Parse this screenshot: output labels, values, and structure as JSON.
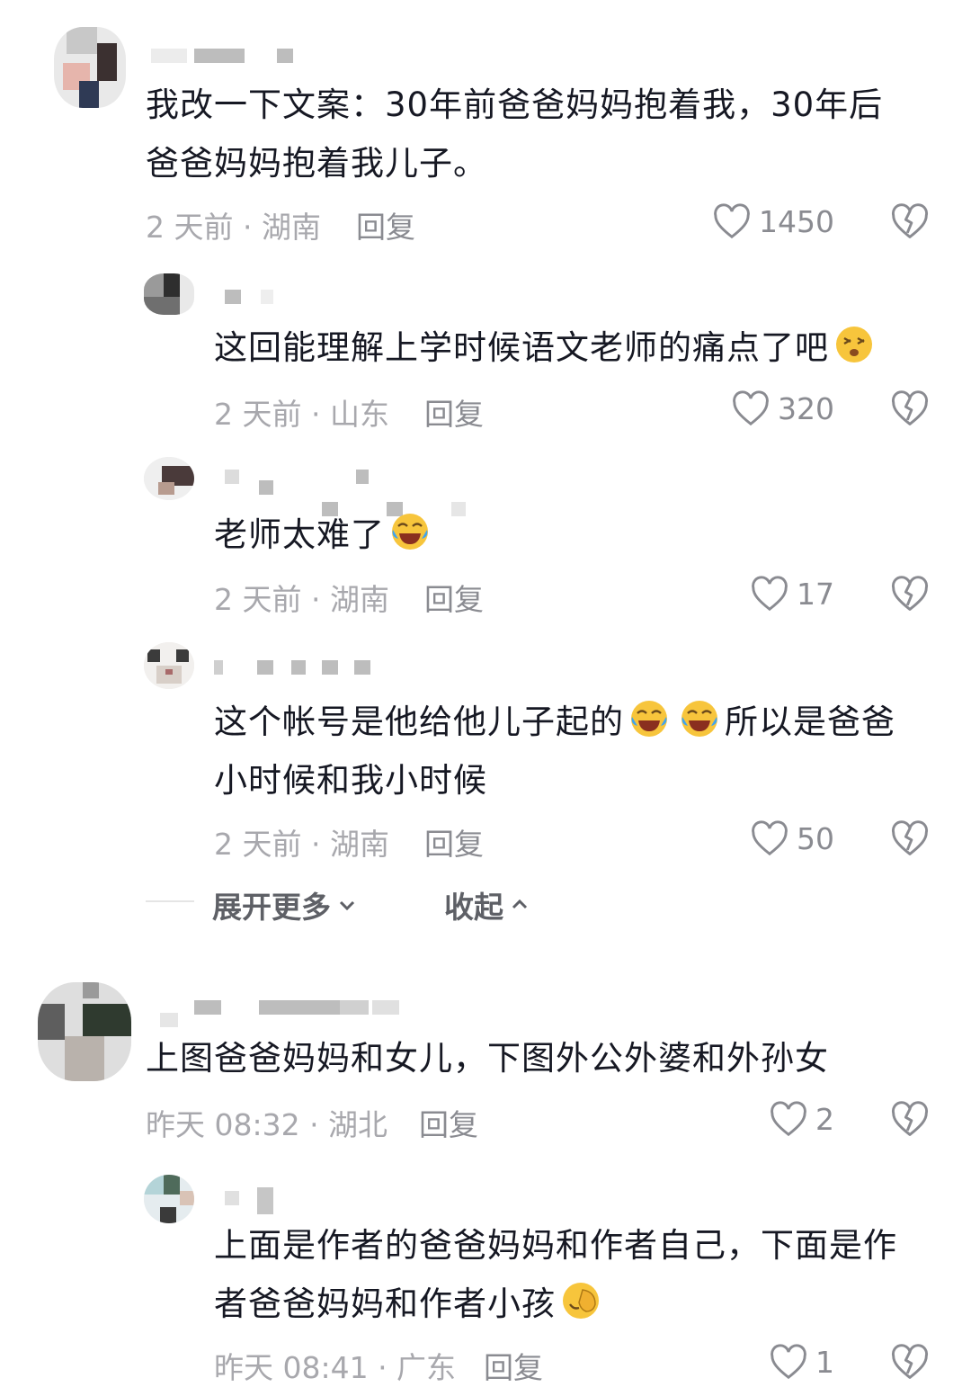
{
  "comments": [
    {
      "text_lines": [
        "我改一下文案：30年前爸爸妈妈抱着我，30年后",
        "爸爸妈妈抱着我儿子。"
      ],
      "meta": "2 天前 · 湖南",
      "reply_label": "回复",
      "likes": "1450"
    },
    {
      "text_lines": [
        "这回能理解上学时候语文老师的痛点了吧"
      ],
      "emoji": "dizzy-face-emoji",
      "meta": "2 天前 · 山东",
      "reply_label": "回复",
      "likes": "320"
    },
    {
      "text_lines": [
        "老师太难了"
      ],
      "emoji": "crying-laughing-emoji",
      "meta": "2 天前 · 湖南",
      "reply_label": "回复",
      "likes": "17"
    },
    {
      "text_lines": [
        "这个帐号是他给他儿子起的",
        "所以是爸爸",
        "小时候和我小时候"
      ],
      "emoji": "crying-laughing-emoji",
      "meta": "2 天前 · 湖南",
      "reply_label": "回复",
      "likes": "50"
    },
    {
      "text_lines": [
        "上图爸爸妈妈和女儿，下图外公外婆和外孙女"
      ],
      "meta": "昨天 08:32 · 湖北",
      "reply_label": "回复",
      "likes": "2"
    },
    {
      "text_lines": [
        "上面是作者的爸爸妈妈和作者自己，下面是作",
        "者爸爸妈妈和作者小孩"
      ],
      "emoji": "facepalm-emoji",
      "meta": "昨天 08:41 · 广东",
      "reply_label": "回复",
      "likes": "1"
    }
  ],
  "thread_controls": {
    "expand_more": "展开更多",
    "collapse": "收起"
  },
  "icons": {
    "like": "heart-outline-icon",
    "dislike": "broken-heart-icon"
  },
  "colors": {
    "text": "#161823",
    "meta": "#a8a8ad",
    "action": "#8a8b91"
  }
}
